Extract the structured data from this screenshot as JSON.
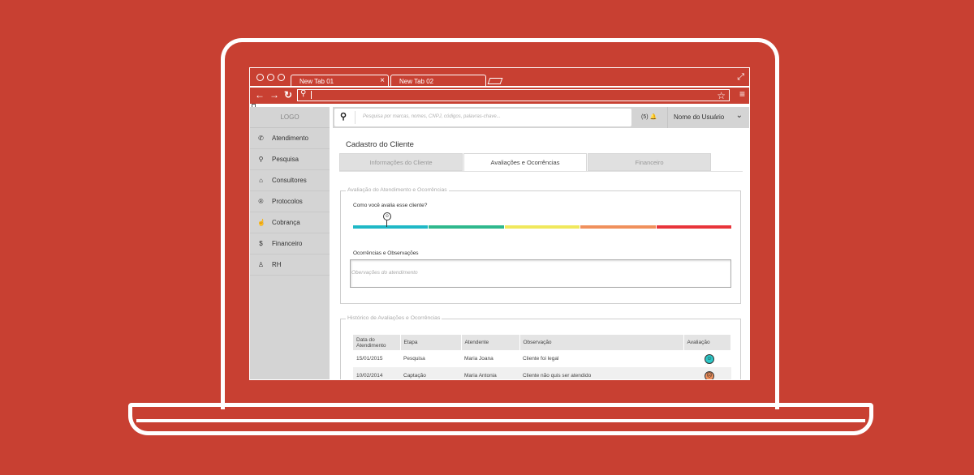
{
  "colors": {
    "background": "#c84032",
    "sidebar": "#d4d4d4",
    "rating_segments": [
      "#1fb8c6",
      "#2eb88d",
      "#f0e85c",
      "#f0905c",
      "#e8343a"
    ],
    "face_good": "#2cc8c8",
    "face_bad": "#f0905c"
  },
  "browser": {
    "tabs": [
      {
        "label": "New Tab 01",
        "close": "×"
      },
      {
        "label": "New Tab 02"
      }
    ],
    "expand_icon": "⤢",
    "nav": {
      "back": "←",
      "forward": "→",
      "reload": "↻"
    },
    "address_value": "",
    "star_icon": "☆",
    "menu_icon": "≡"
  },
  "sidebar": {
    "logo": "LOGO",
    "items": [
      {
        "icon": "✆",
        "icon_name": "phone-icon",
        "label": "Atendimento"
      },
      {
        "icon": "⚲",
        "icon_name": "search-icon",
        "label": "Pesquisa"
      },
      {
        "icon": "⌂",
        "icon_name": "home-icon",
        "label": "Consultores"
      },
      {
        "icon": "®",
        "icon_name": "registered-icon",
        "label": "Protocolos"
      },
      {
        "icon": "☝",
        "icon_name": "hand-icon",
        "label": "Cobrança"
      },
      {
        "icon": "$",
        "icon_name": "dollar-icon",
        "label": "Financeiro"
      },
      {
        "icon": "♙",
        "icon_name": "person-icon",
        "label": "RH"
      }
    ]
  },
  "topbar": {
    "search_placeholder": "Pesquisa por marcas, nomes, CNPJ, códigos, palavras-chave...",
    "search_icon": "⚲",
    "notifications": "(5)",
    "bell_icon": "🔔",
    "user_name": "Nome do Usuário",
    "chevron": "⌄"
  },
  "main": {
    "title": "Cadastro do Cliente",
    "tabs": [
      "Informações do Cliente",
      "Avaliações e Ocorrências",
      "Financeiro"
    ],
    "active_tab": 1,
    "evaluation": {
      "legend": "Avaliação do Atendimento e Ocorrências",
      "question": "Como você avalia  esse cliente?",
      "rating_level": 0.09,
      "observations_label": "Ocorrências e Observações",
      "observations_placeholder": "Obervações do atendimento"
    },
    "history": {
      "legend": "Histórico de Avaliações e Ocorrências",
      "columns": [
        "Data do Atendimento",
        "Etapa",
        "Atendente",
        "Observação",
        "Avaliação"
      ],
      "rows": [
        {
          "date": "15/01/2015",
          "stage": "Pesquisa",
          "agent": "Maria Joana",
          "note": "Cliente foi legal",
          "rating": "good"
        },
        {
          "date": "10/02/2014",
          "stage": "Captação",
          "agent": "Maria Antonia",
          "note": "Cliente não quis ser atendido",
          "rating": "bad"
        }
      ]
    }
  }
}
